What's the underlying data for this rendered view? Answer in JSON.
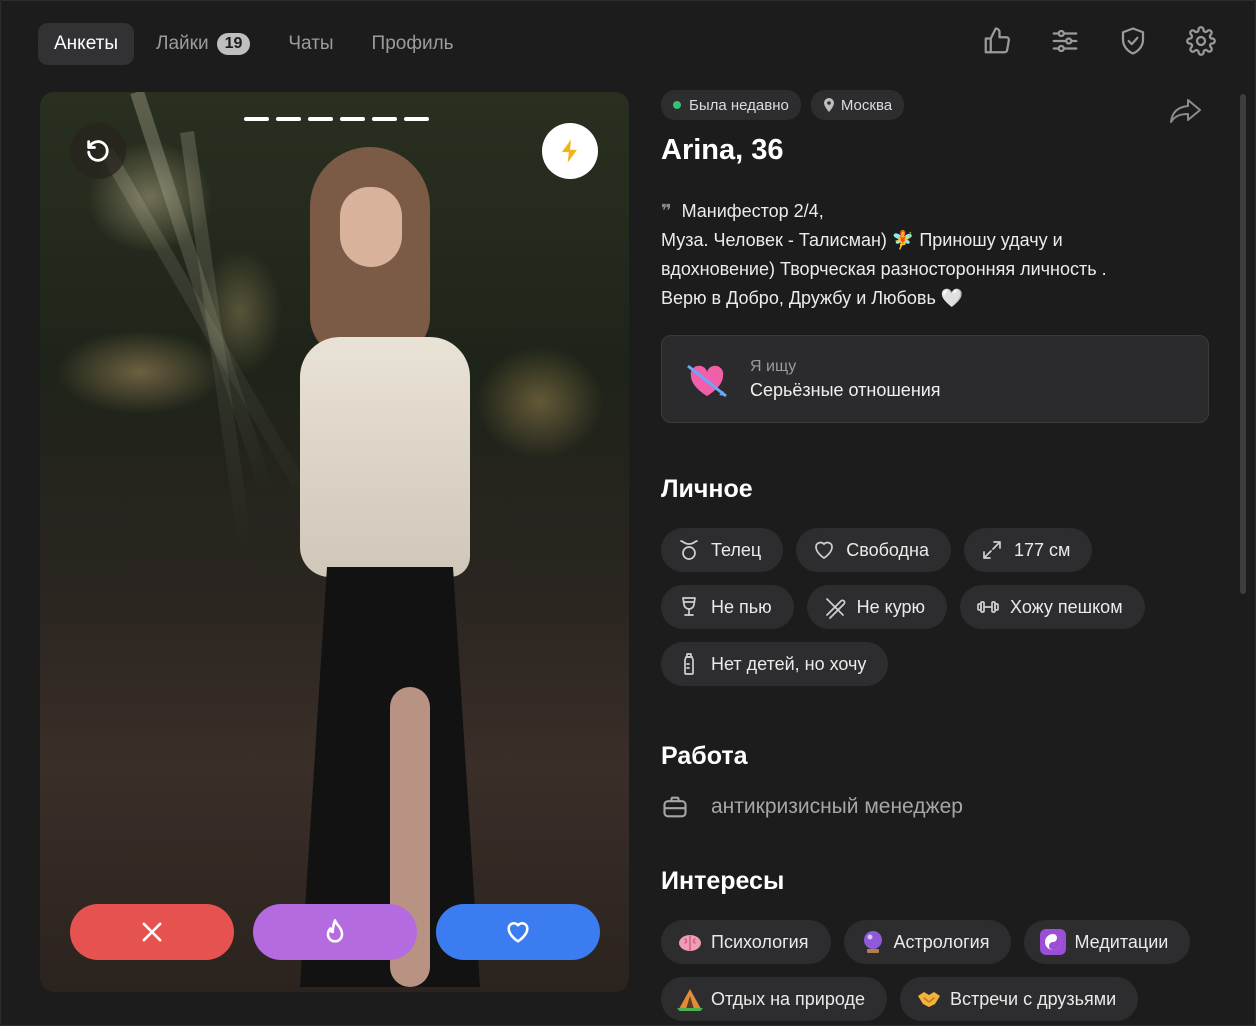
{
  "nav": {
    "tabs": [
      {
        "label": "Анкеты",
        "active": true
      },
      {
        "label": "Лайки",
        "badge": "19"
      },
      {
        "label": "Чаты"
      },
      {
        "label": "Профиль"
      }
    ]
  },
  "top_icons": [
    "thumbs-up-icon",
    "filters-icon",
    "shield-check-icon",
    "settings-icon"
  ],
  "card": {
    "photo_count": 6,
    "actions": [
      "dislike",
      "superlike",
      "like"
    ]
  },
  "profile": {
    "status": "Была недавно",
    "city": "Москва",
    "name_age": "Arina, 36",
    "bio": {
      "line1": "Манифестор 2/4,",
      "line2": "Муза. Человек - Талисман) 🧚 Приношу удачу и",
      "line3": "вдохновение) Творческая разносторонняя личность .",
      "line4": "Верю в Добро, Дружбу и Любовь 🤍"
    },
    "seeking": {
      "label": "Я ищу",
      "value": "Серьёзные отношения"
    },
    "personal": {
      "title": "Личное",
      "items": [
        "Телец",
        "Свободна",
        "177 см",
        "Не пью",
        "Не курю",
        "Хожу пешком",
        "Нет детей, но хочу"
      ]
    },
    "work": {
      "title": "Работа",
      "value": "антикризисный менеджер"
    },
    "interests": {
      "title": "Интересы",
      "items": [
        "Психология",
        "Астрология",
        "Медитации",
        "Отдых на природе",
        "Встречи с друзьями"
      ]
    }
  },
  "colors": {
    "background": "#1c1c1d",
    "dislike": "#e5524f",
    "superlike": "#b46be0",
    "like": "#3b7df0",
    "online": "#38c172"
  }
}
